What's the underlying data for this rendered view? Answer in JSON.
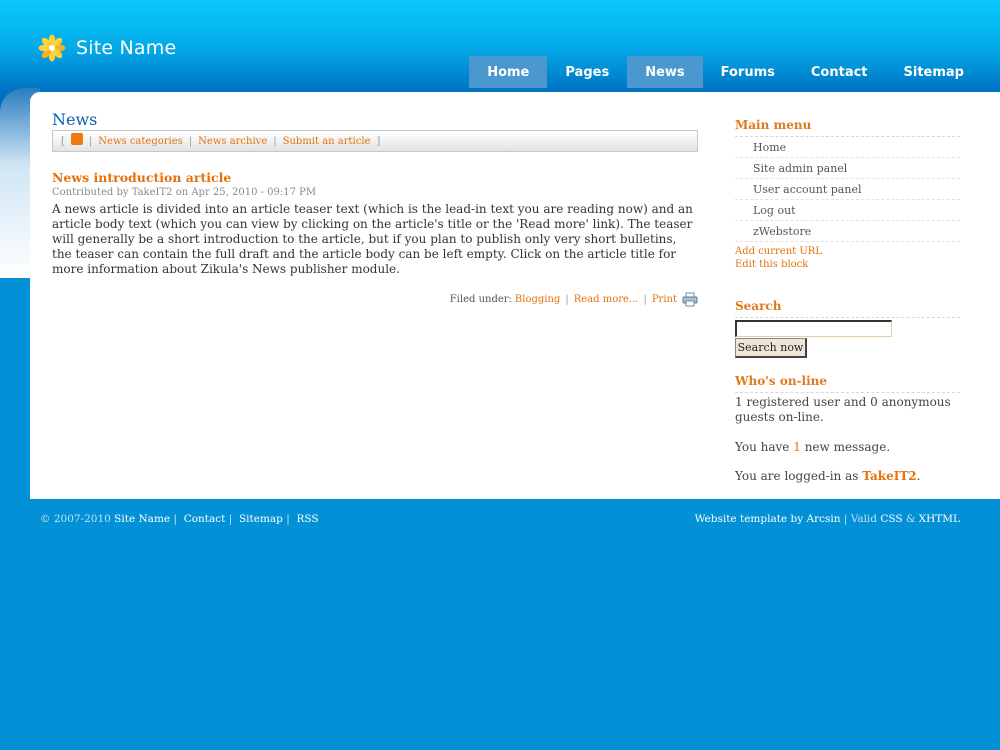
{
  "site": {
    "name": "Site Name"
  },
  "nav": [
    {
      "label": "Home",
      "active": true
    },
    {
      "label": "Pages",
      "active": false
    },
    {
      "label": "News",
      "active": true
    },
    {
      "label": "Forums",
      "active": false
    },
    {
      "label": "Contact",
      "active": false
    },
    {
      "label": "Sitemap",
      "active": false
    }
  ],
  "main": {
    "title": "News",
    "subnav": [
      "News categories",
      "News archive",
      "Submit an article"
    ],
    "article": {
      "title": "News introduction article",
      "meta": "Contributed by TakeIT2 on Apr 25, 2010 - 09:17 PM",
      "teaser": "A news article is divided into an article teaser text (which is the lead-in text you are reading now) and an article body text (which you can view by clicking on the article's title or the 'Read more' link). The teaser will generally be a short introduction to the article, but if you plan to publish only very short bulletins, the teaser can contain the full draft and the article body can be left empty. Click on the article title for more information about Zikula's News publisher module.",
      "filed_label": "Filed under:",
      "category": "Blogging",
      "read_more": "Read more...",
      "print": "Print"
    }
  },
  "sidebar": {
    "main_menu": {
      "title": "Main menu",
      "items": [
        "Home",
        "Site admin panel",
        "User account panel",
        "Log out",
        "zWebstore"
      ],
      "add_url": "Add current URL",
      "edit_block": "Edit this block"
    },
    "search": {
      "title": "Search",
      "button": "Search now",
      "value": ""
    },
    "online": {
      "title": "Who's on-line",
      "text": "1 registered user and 0 anonymous guests on-line.",
      "msg_pre": "You have ",
      "msg_count": "1",
      "msg_post": " new message.",
      "logged_pre": "You are logged-in as ",
      "user": "TakeIT2",
      "logged_post": "."
    }
  },
  "footer": {
    "copyright": "© 2007-2010 ",
    "site": "Site Name",
    "contact": "Contact",
    "sitemap": "Sitemap",
    "rss": "RSS",
    "template_pre": "Website template by ",
    "author": "Arcsin",
    "valid": " | Valid ",
    "css": "CSS",
    "amp": " & ",
    "xhtml": "XHTML"
  },
  "colors": {
    "accent": "#e4710c",
    "brand": "#0291d6",
    "title": "#0a5faa"
  }
}
